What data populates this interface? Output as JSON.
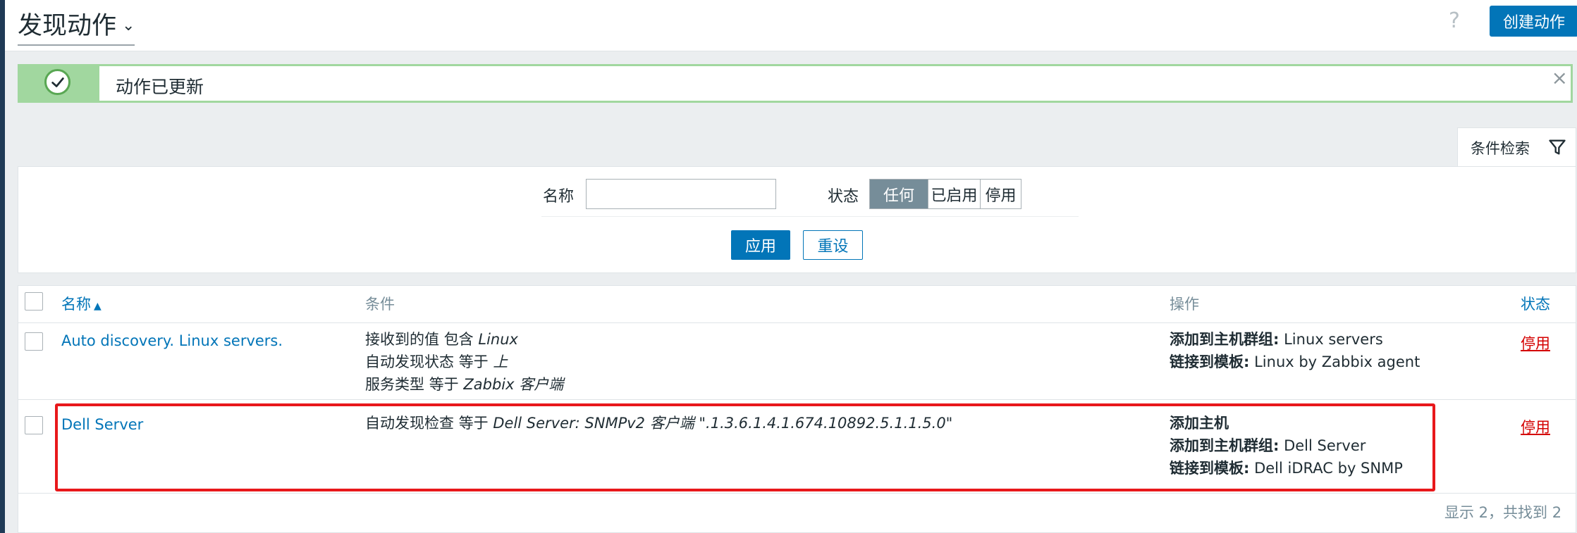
{
  "header": {
    "title": "发现动作",
    "help_icon": "question-mark-icon",
    "create_button": "创建动作"
  },
  "message": {
    "text": "动作已更新",
    "icon": "check-circle-icon",
    "close": "×"
  },
  "filter": {
    "tab_label": "条件检索",
    "name_label": "名称",
    "name_value": "",
    "state_label": "状态",
    "state_options": [
      "任何",
      "已启用",
      "停用"
    ],
    "state_selected": "任何",
    "apply": "应用",
    "reset": "重设"
  },
  "table": {
    "columns": {
      "name": "名称",
      "conditions": "条件",
      "operations": "操作",
      "status": "状态"
    },
    "rows": [
      {
        "name": "Auto discovery. Linux servers.",
        "conditions": [
          {
            "label": "接收到的值",
            "op": "包含",
            "value": "Linux"
          },
          {
            "label": "自动发现状态",
            "op": "等于",
            "value": "上"
          },
          {
            "label": "服务类型",
            "op": "等于",
            "value": "Zabbix 客户端"
          }
        ],
        "operations": [
          {
            "label": "添加到主机群组:",
            "value": "Linux servers"
          },
          {
            "label": "链接到模板:",
            "value": "Linux by Zabbix agent"
          }
        ],
        "status": "停用"
      },
      {
        "name": "Dell Server",
        "conditions": [
          {
            "label": "自动发现检查",
            "op": "等于",
            "value": "Dell Server: SNMPv2 客户端 \".1.3.6.1.4.1.674.10892.5.1.1.5.0\""
          }
        ],
        "operations": [
          {
            "label": "添加主机",
            "value": ""
          },
          {
            "label": "添加到主机群组:",
            "value": "Dell Server"
          },
          {
            "label": "链接到模板:",
            "value": "Dell iDRAC by SNMP"
          }
        ],
        "status": "停用"
      }
    ],
    "footer": "显示 2，共找到 2"
  }
}
